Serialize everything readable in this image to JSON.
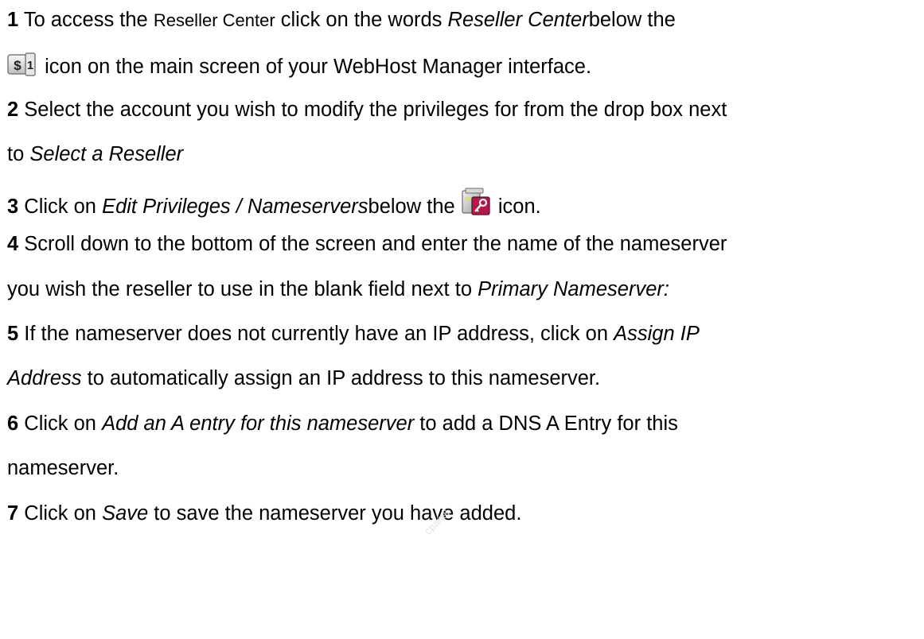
{
  "steps": [
    {
      "number": "1",
      "text_a": "To access the",
      "text_b": "Reseller Center",
      "text_c": "click on the words",
      "em_d": "Reseller Center",
      "text_e": "below the",
      "text_f": "icon on the main screen of your WebHost Manager interface.",
      "icon": "dollar-sign-icon"
    },
    {
      "number": "2",
      "text_a": "Select the account you wish to modify the privileges for from the drop box next",
      "text_b": "to",
      "em_c": "Select a Reseller"
    },
    {
      "number": "3",
      "text_a": "Click on",
      "em_b": "Edit Privileges / Nameservers",
      "text_c": "below the",
      "text_d": "icon.",
      "icon": "edit-privileges-key-icon"
    },
    {
      "number": "4",
      "text_a": "Scroll down to the bottom of the screen and enter the name of the nameserver",
      "text_b": "you wish the reseller to use in the blank field next to",
      "em_c": "Primary Nameserver:"
    },
    {
      "number": "5",
      "text_a": "If the nameserver does not currently have an IP address, click on",
      "em_b": "Assign IP",
      "em_c": "Address",
      "text_d": "to automatically assign an IP address to this nameserver."
    },
    {
      "number": "6",
      "text_a": "Click on",
      "em_b": "Add an A entry for this nameserver",
      "text_c": "to add a DNS A Entry for this",
      "text_d": "nameserver."
    },
    {
      "number": "7",
      "text_a": "Click on",
      "em_b": "Save",
      "text_c": "to save the nameserver you have added."
    }
  ],
  "watermark": "cpanel"
}
